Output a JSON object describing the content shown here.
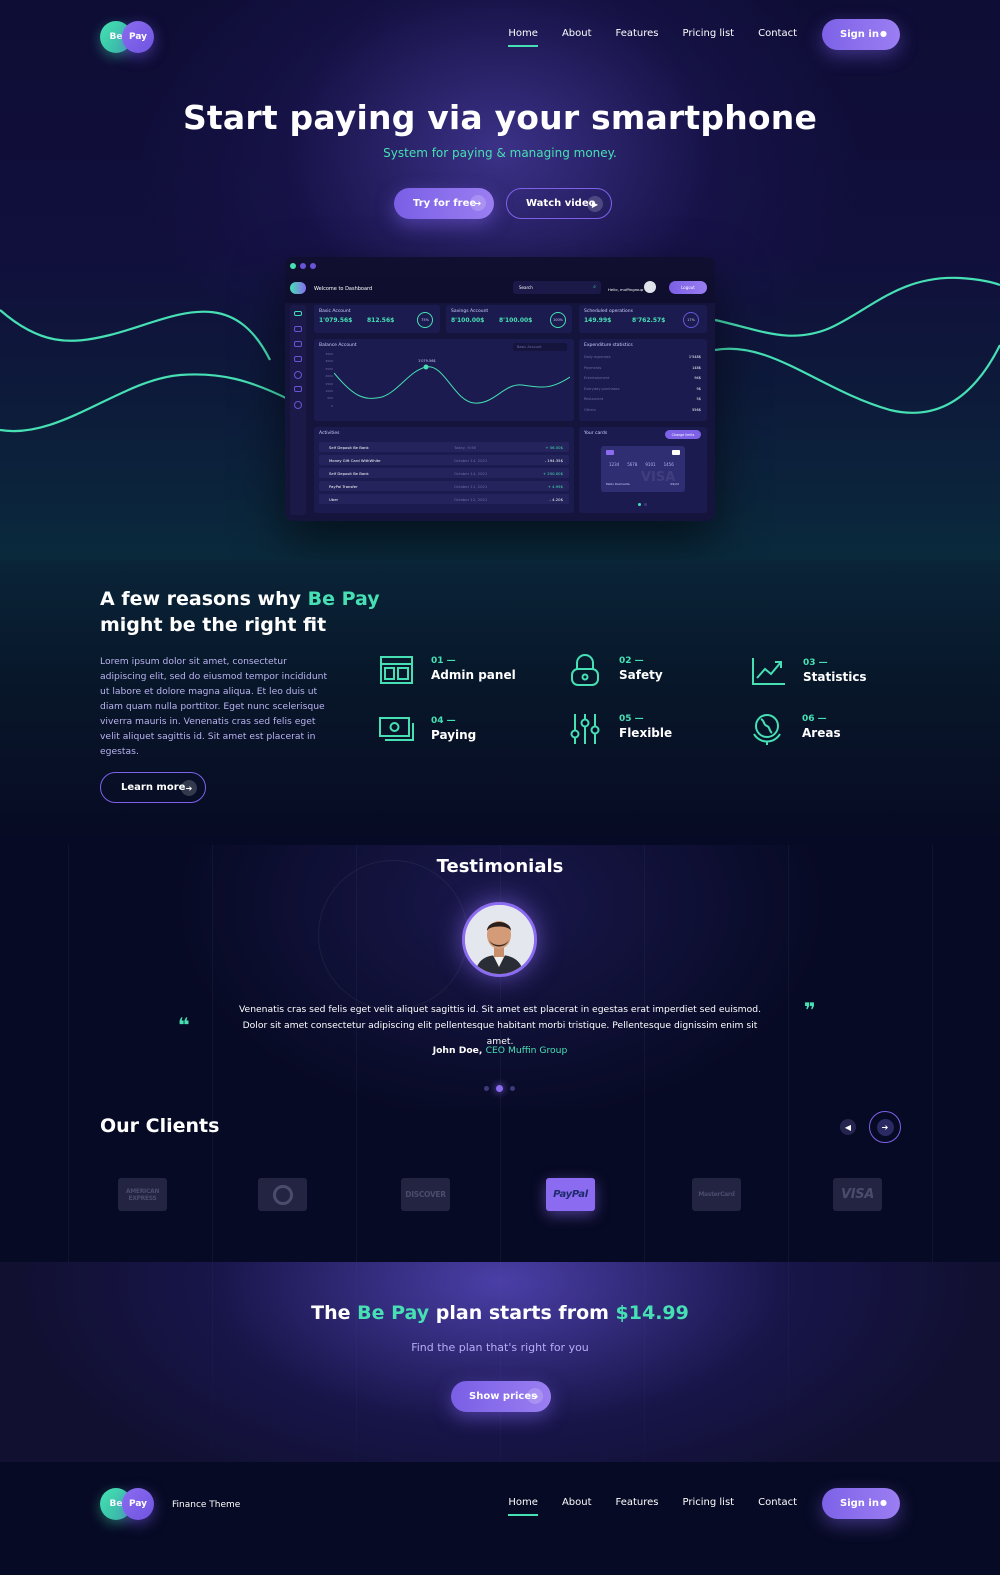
{
  "brand": {
    "logo_left": "Be",
    "logo_right": "Pay",
    "tagline": "Finance Theme"
  },
  "nav": {
    "items": [
      {
        "label": "Home"
      },
      {
        "label": "About"
      },
      {
        "label": "Features"
      },
      {
        "label": "Pricing list"
      },
      {
        "label": "Contact"
      }
    ],
    "active": "Home",
    "signin_label": "Sign in"
  },
  "hero": {
    "title": "Start paying via your smartphone",
    "subtitle": "System for paying & managing money.",
    "try_label": "Try for free",
    "watch_label": "Watch video"
  },
  "dashboard": {
    "welcome": "Welcome to Dashboard",
    "search_placeholder": "Search",
    "greeting": "Hello, muffingroup",
    "logout_label": "Logout",
    "basic_account": {
      "title": "Basic Account",
      "value1": "1'079.56$",
      "value2": "812.56$",
      "percent": "75%"
    },
    "savings_account": {
      "title": "Savings Account",
      "value1": "8'100.00$",
      "value2": "8'100.00$",
      "percent": "100%"
    },
    "scheduled": {
      "title": "Scheduled operations",
      "value1": "149.99$",
      "value2": "8'762.57$",
      "percent": "17%"
    },
    "balance": {
      "title": "Balance Account",
      "dropdown": "Basic Account",
      "peak_label": "1'079.56$",
      "y_ticks": [
        "3500",
        "3000",
        "2500",
        "2000",
        "1500",
        "1000",
        "500",
        "0"
      ]
    },
    "expenditure": {
      "title": "Expenditure statistics",
      "rows": [
        {
          "label": "Daily expenses",
          "value": "1'548$"
        },
        {
          "label": "Payments",
          "value": "148$"
        },
        {
          "label": "Entertainment",
          "value": "94$"
        },
        {
          "label": "Everyday purchases",
          "value": "9$"
        },
        {
          "label": "Restaurant",
          "value": "5$"
        },
        {
          "label": "Others",
          "value": "556$"
        }
      ]
    },
    "activities": {
      "title": "Activities",
      "rows": [
        {
          "name": "Self Deposit Be Bank",
          "date": "Today, 9:56",
          "amount": "+ 56.50$"
        },
        {
          "name": "Money Gift Card WithWhite",
          "date": "October 14, 2021",
          "amount": "- 194.35$"
        },
        {
          "name": "Self Deposit Be Bank",
          "date": "October 14, 2021",
          "amount": "+ 250.00$"
        },
        {
          "name": "PayPal Transfer",
          "date": "October 11, 2021",
          "amount": "+ 4.99$"
        },
        {
          "name": "Uber",
          "date": "October 12, 2021",
          "amount": "- 4.20$"
        }
      ]
    },
    "cards": {
      "title": "Your cards",
      "button": "Change limits",
      "number": [
        "1234",
        "5678",
        "9101",
        "1456"
      ],
      "holder": "Pablo Diamante",
      "expiry": "09/22",
      "brand": "VISA"
    }
  },
  "reasons": {
    "title_pre": "A few reasons why ",
    "title_brand": "Be Pay",
    "title_post": "might be the right fit",
    "body": "Lorem ipsum dolor sit amet, consectetur adipiscing elit, sed do eiusmod tempor incididunt ut labore et dolore magna aliqua. Et leo duis ut diam quam nulla porttitor. Eget nunc scelerisque viverra mauris in. Venenatis cras sed felis eget velit aliquet sagittis id. Sit amet est placerat in egestas.",
    "learn_label": "Learn more",
    "features": [
      {
        "num": "01 —",
        "name": "Admin panel",
        "icon": "admin-panel-icon"
      },
      {
        "num": "02 —",
        "name": "Safety",
        "icon": "padlock-icon"
      },
      {
        "num": "03 —",
        "name": "Statistics",
        "icon": "chart-icon"
      },
      {
        "num": "04 —",
        "name": "Paying",
        "icon": "banknote-icon"
      },
      {
        "num": "05 —",
        "name": "Flexible",
        "icon": "sliders-icon"
      },
      {
        "num": "06 —",
        "name": "Areas",
        "icon": "globe-icon"
      }
    ]
  },
  "testimonials": {
    "title": "Testimonials",
    "quote": "Venenatis cras sed felis eget velit aliquet sagittis id. Sit amet est placerat in egestas erat imperdiet sed euismod. Dolor sit amet consectetur adipiscing elit pellentesque habitant morbi tristique. Pellentesque dignissim enim sit amet.",
    "author": "John Doe, ",
    "role": "CEO Muffin Group"
  },
  "clients": {
    "title": "Our Clients",
    "logos": [
      "AMERICAN EXPRESS",
      "Diners Club",
      "DISCOVER",
      "PayPal",
      "MasterCard",
      "VISA"
    ]
  },
  "cta": {
    "title_pre": "The ",
    "title_brand": "Be Pay",
    "title_mid": " plan starts from ",
    "price": "$14.99",
    "subtitle": "Find the plan that's right for you",
    "button_label": "Show prices"
  },
  "colors": {
    "accent": "#46e0b4",
    "primary": "#8b6cf0",
    "background": "#070a24"
  }
}
